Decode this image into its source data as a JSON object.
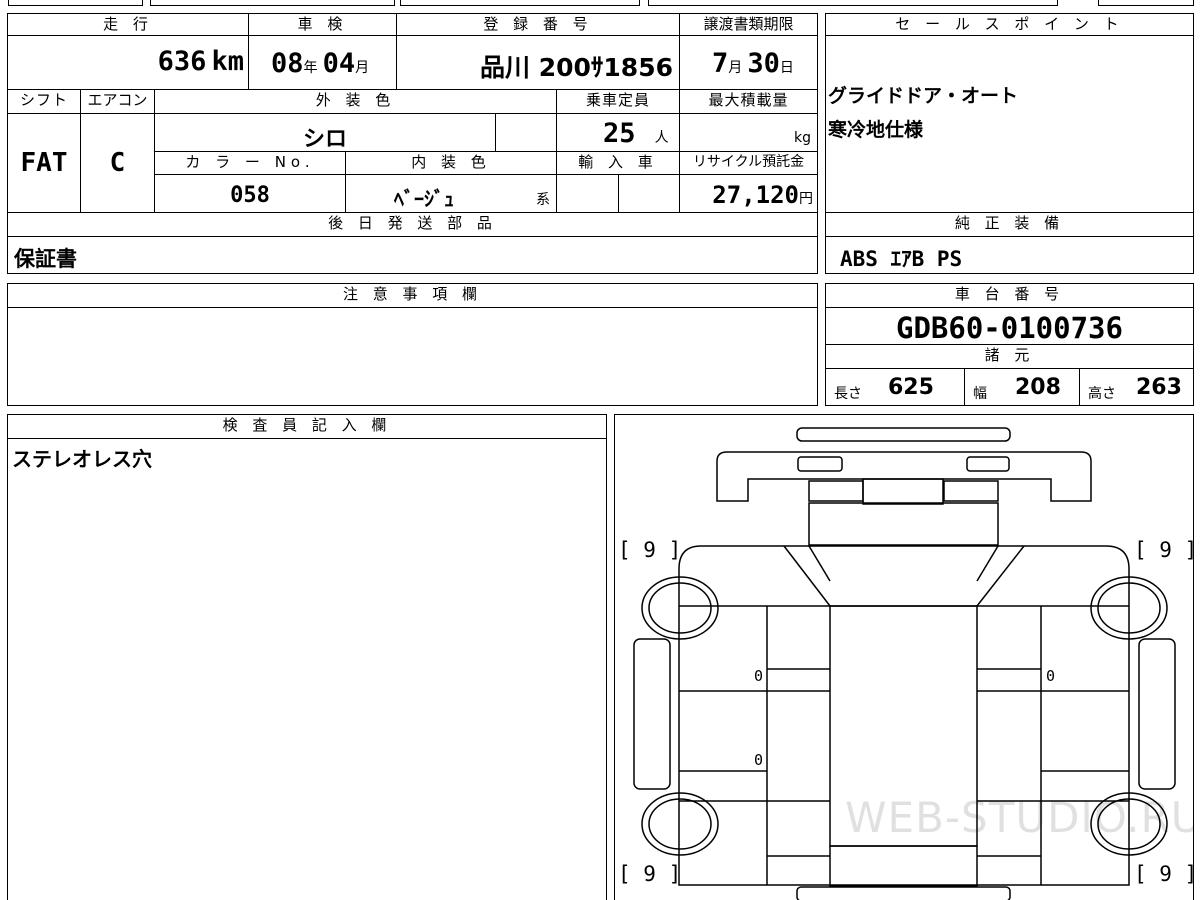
{
  "basic": {
    "mileage_label": "走 行",
    "mileage_value": "636",
    "mileage_unit": "km",
    "inspection_label": "車 検",
    "inspection_year": "08",
    "inspection_year_unit": "年",
    "inspection_month": "04",
    "inspection_month_unit": "月",
    "registration_label": "登 録 番 号",
    "registration_value": "品川 200ｻ1856",
    "transfer_label": "譲渡書類期限",
    "transfer_month": "7",
    "transfer_month_unit": "月",
    "transfer_day": "30",
    "transfer_day_unit": "日"
  },
  "details": {
    "shift_label": "シフト",
    "shift_value": "FAT",
    "ac_label": "エアコン",
    "ac_value": "C",
    "exterior_label": "外 装 色",
    "exterior_value": "シロ",
    "capacity_label": "乗車定員",
    "capacity_value": "25",
    "capacity_unit": "人",
    "load_label": "最大積載量",
    "load_unit": "kg",
    "color_no_label": "カ ラ ー No.",
    "color_no_value": "058",
    "interior_label": "内 装 色",
    "interior_value": "ﾍﾞｰｼﾞｭ",
    "interior_suffix": "系",
    "import_label": "輸 入 車",
    "recycle_label": "リサイクル預託金",
    "recycle_value": "27,120",
    "recycle_unit": "円"
  },
  "sales_point": {
    "label": "セ ー ル ス ポ イ ン ト",
    "line1": "グライドドア・オート",
    "line2": "寒冷地仕様"
  },
  "later_parts": {
    "label": "後 日 発 送 部 品",
    "value": "保証書"
  },
  "genuine_equipment": {
    "label": "純 正 装 備",
    "value": "ABS ｴｱB PS"
  },
  "notes": {
    "label": "注 意 事 項 欄",
    "value": ""
  },
  "chassis": {
    "label": "車 台 番 号",
    "value": "GDB60-0100736"
  },
  "specs": {
    "label": "諸 元",
    "length_label": "長さ",
    "length_value": "625",
    "width_label": "幅",
    "width_value": "208",
    "height_label": "高さ",
    "height_value": "263"
  },
  "inspector": {
    "label": "検 査 員 記 入 欄",
    "value": "ステレオレス穴"
  },
  "diagram": {
    "tire_top_left": "[ 9 ]",
    "tire_top_right": "[ 9 ]",
    "tire_bottom_left": "[ 9 ]",
    "tire_bottom_right": "[ 9 ]",
    "mark_right_door": "0",
    "mark_left_front_door": "0",
    "mark_left_rear_door": "0"
  },
  "watermark": "WEB-STUDIO.RU"
}
